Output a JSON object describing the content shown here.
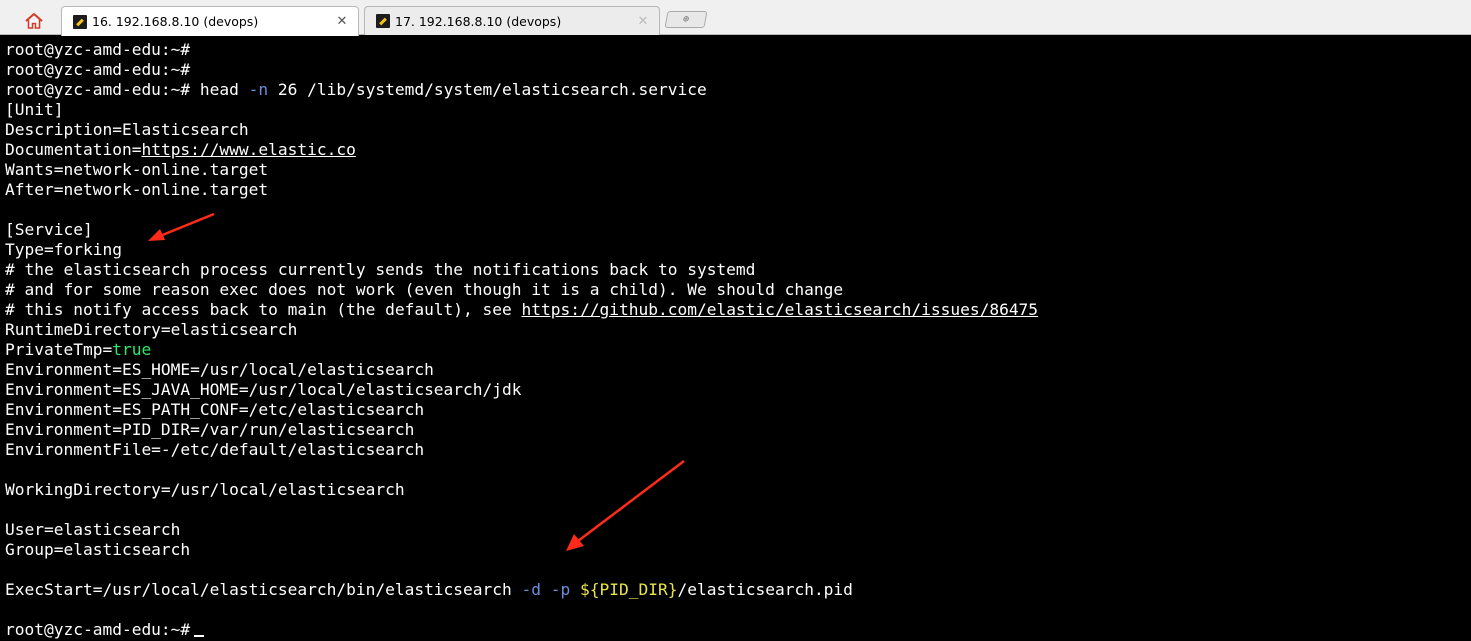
{
  "tabs": [
    {
      "title": "16. 192.168.8.10 (devops)",
      "close": "✕",
      "active": true
    },
    {
      "title": "17. 192.168.8.10 (devops)",
      "close": "✕",
      "active": false
    }
  ],
  "new_tab_icon": "⊕",
  "colors": {
    "background": "#000000",
    "text": "#ffffff",
    "option": "#6a8ddb",
    "boolean": "#2ee86b",
    "variable": "#e8e54b",
    "annotation_arrow": "#ff2a1a"
  },
  "terminal": {
    "lines": [
      [
        {
          "t": "root@yzc-amd-edu:~#"
        }
      ],
      [
        {
          "t": "root@yzc-amd-edu:~#"
        }
      ],
      [
        {
          "t": "root@yzc-amd-edu:~# head "
        },
        {
          "t": "-n",
          "c": "blue"
        },
        {
          "t": " 26 /lib/systemd/system/elasticsearch.service"
        }
      ],
      [
        {
          "t": "[Unit]"
        }
      ],
      [
        {
          "t": "Description=Elasticsearch"
        }
      ],
      [
        {
          "t": "Documentation="
        },
        {
          "t": "https://www.elastic.co",
          "link": true
        }
      ],
      [
        {
          "t": "Wants=network-online.target"
        }
      ],
      [
        {
          "t": "After=network-online.target"
        }
      ],
      [
        {
          "t": ""
        }
      ],
      [
        {
          "t": "[Service]"
        }
      ],
      [
        {
          "t": "Type=forking"
        }
      ],
      [
        {
          "t": "# the elasticsearch process currently sends the notifications back to systemd"
        }
      ],
      [
        {
          "t": "# and for some reason exec does not work (even though it is a child). We should change"
        }
      ],
      [
        {
          "t": "# this notify access back to main (the default), see "
        },
        {
          "t": "https://github.com/elastic/elasticsearch/issues/86475",
          "link": true
        }
      ],
      [
        {
          "t": "RuntimeDirectory=elasticsearch"
        }
      ],
      [
        {
          "t": "PrivateTmp="
        },
        {
          "t": "true",
          "c": "green"
        }
      ],
      [
        {
          "t": "Environment=ES_HOME=/usr/local/elasticsearch"
        }
      ],
      [
        {
          "t": "Environment=ES_JAVA_HOME=/usr/local/elasticsearch/jdk"
        }
      ],
      [
        {
          "t": "Environment=ES_PATH_CONF=/etc/elasticsearch"
        }
      ],
      [
        {
          "t": "Environment=PID_DIR=/var/run/elasticsearch"
        }
      ],
      [
        {
          "t": "EnvironmentFile=-/etc/default/elasticsearch"
        }
      ],
      [
        {
          "t": ""
        }
      ],
      [
        {
          "t": "WorkingDirectory=/usr/local/elasticsearch"
        }
      ],
      [
        {
          "t": ""
        }
      ],
      [
        {
          "t": "User=elasticsearch"
        }
      ],
      [
        {
          "t": "Group=elasticsearch"
        }
      ],
      [
        {
          "t": ""
        }
      ],
      [
        {
          "t": "ExecStart=/usr/local/elasticsearch/bin/elasticsearch "
        },
        {
          "t": "-d",
          "c": "blue"
        },
        {
          "t": " "
        },
        {
          "t": "-p",
          "c": "blue"
        },
        {
          "t": " "
        },
        {
          "t": "${PID_DIR}",
          "c": "yellow"
        },
        {
          "t": "/elasticsearch.pid"
        }
      ],
      [
        {
          "t": ""
        }
      ],
      [
        {
          "t": "root@yzc-amd-edu:~#"
        },
        {
          "cursor": true
        }
      ]
    ]
  }
}
